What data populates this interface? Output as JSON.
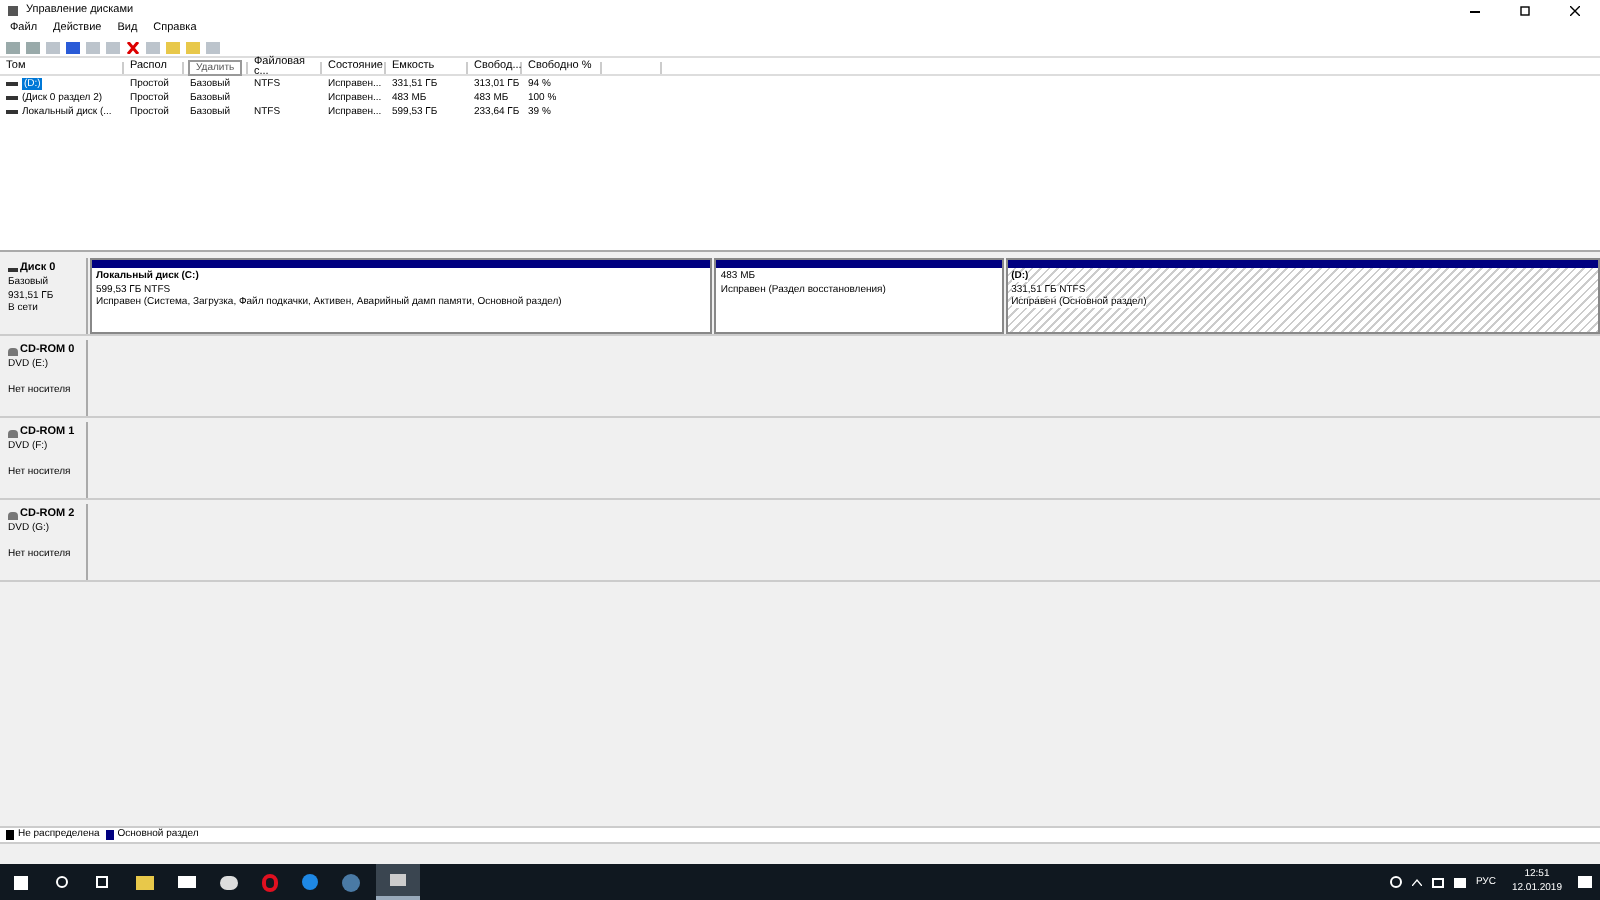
{
  "window": {
    "title": "Управление дисками"
  },
  "menu": [
    "Файл",
    "Действие",
    "Вид",
    "Справка"
  ],
  "tooltip": "Удалить",
  "table": {
    "columns": [
      {
        "label": "Том"
      },
      {
        "label": "Распол"
      },
      {},
      {
        "label": "Файловая с..."
      },
      {
        "label": "Состояние"
      },
      {
        "label": "Емкость"
      },
      {
        "label": "Свобод..."
      },
      {
        "label": "Свободно %"
      }
    ],
    "rows": [
      {
        "selected": true,
        "cells": [
          "(D:)",
          "Простой",
          "Базовый",
          "NTFS",
          "Исправен...",
          "331,51 ГБ",
          "313,01 ГБ",
          "94 %"
        ]
      },
      {
        "selected": false,
        "cells": [
          "(Диск 0 раздел 2)",
          "Простой",
          "Базовый",
          "",
          "Исправен...",
          "483 МБ",
          "483 МБ",
          "100 %"
        ]
      },
      {
        "selected": false,
        "cells": [
          "Локальный диск (...",
          "Простой",
          "Базовый",
          "NTFS",
          "Исправен...",
          "599,53 ГБ",
          "233,64 ГБ",
          "39 %"
        ]
      }
    ]
  },
  "disks": [
    {
      "kind": "disk",
      "name": "Диск 0",
      "lines": [
        "Базовый",
        "931,51 ГБ",
        "В сети"
      ],
      "partitions": [
        {
          "title": "Локальный диск  (C:)",
          "size": "599,53 ГБ NTFS",
          "status": "Исправен (Система, Загрузка, Файл подкачки, Активен, Аварийный дамп памяти, Основной раздел)",
          "selected": false
        },
        {
          "size": "483 МБ",
          "status": "Исправен (Раздел восстановления)",
          "selected": false
        },
        {
          "title": "(D:)",
          "size": "331,51 ГБ NTFS",
          "status": "Исправен (Основной раздел)",
          "selected": true
        }
      ]
    },
    {
      "kind": "cdrom",
      "name": "CD-ROM 0",
      "lines": [
        "DVD (E:)"
      ],
      "media": "Нет носителя"
    },
    {
      "kind": "cdrom",
      "name": "CD-ROM 1",
      "lines": [
        "DVD (F:)"
      ],
      "media": "Нет носителя"
    },
    {
      "kind": "cdrom",
      "name": "CD-ROM 2",
      "lines": [
        "DVD (G:)"
      ],
      "media": "Нет носителя"
    }
  ],
  "legend": [
    {
      "label": "Не распределена",
      "color": "#000000"
    },
    {
      "label": "Основной раздел",
      "color": "#000080"
    }
  ],
  "taskbar": {
    "language": "РУС",
    "time": "12:51",
    "date": "12.01.2019"
  }
}
